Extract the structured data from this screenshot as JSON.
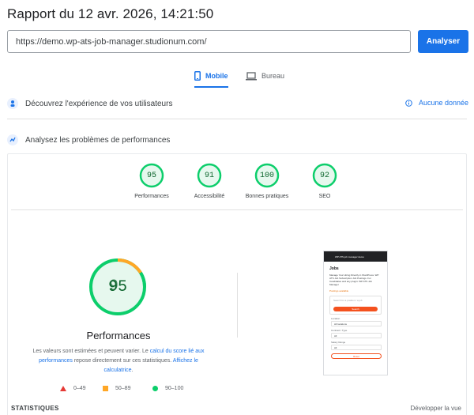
{
  "header": {
    "title": "Rapport du 12 avr. 2026, 14:21:50"
  },
  "url_bar": {
    "value": "https://demo.wp-ats-job-manager.studionum.com/",
    "button_label": "Analyser"
  },
  "device_tabs": {
    "mobile_label": "Mobile",
    "desktop_label": "Bureau",
    "selected": "Mobile"
  },
  "field_data": {
    "heading": "Découvrez l'expérience de vos utilisateurs",
    "status": "Aucune donnée"
  },
  "lab_data": {
    "heading": "Analysez les problèmes de performances"
  },
  "scores": [
    {
      "label": "Performances",
      "value": 95
    },
    {
      "label": "Accessibilité",
      "value": 91
    },
    {
      "label": "Bonnes pratiques",
      "value": 100
    },
    {
      "label": "SEO",
      "value": 92
    }
  ],
  "main_score": {
    "value": 95,
    "ghost_value": "9",
    "label": "Performances"
  },
  "description": {
    "part1": "Les valeurs sont estimées et peuvent varier. Le ",
    "link1": "calcul du score lié aux performances",
    "part2": " repose directement sur ces statistiques. ",
    "link2": "Affichez le calculatrice",
    "part3": "."
  },
  "legend": [
    {
      "range": "0–49",
      "color": "#e53935"
    },
    {
      "range": "50–89",
      "color": "#ffa726"
    },
    {
      "range": "90–100",
      "color": "#0cce6b"
    }
  ],
  "screenshot": {
    "bar_text": "WP ATS job manager demo",
    "heading": "Jobs",
    "paragraph": "Manage Your Hiring Directly in WordPress. WP ATS Job Subscription Job Postings. For Candidates and any plugin: WP ATS Job Manager",
    "tag": "Postings available",
    "search_placeholder": "Search for a position / a job",
    "search_button": "Search",
    "field1_label": "Location",
    "field1_value": "All locations",
    "field2_label": "Contract / Type",
    "field2_value": "All",
    "field3_label": "Salary Range",
    "field3_value": "All",
    "reset_button": "Reset"
  },
  "stats": {
    "label": "STATISTIQUES",
    "expand_label": "Développer la vue"
  },
  "colors": {
    "accent": "#1a73e8",
    "pass": "#0cce6b",
    "pass_text": "#0d652d",
    "average": "#ffa726",
    "fail": "#e53935"
  }
}
